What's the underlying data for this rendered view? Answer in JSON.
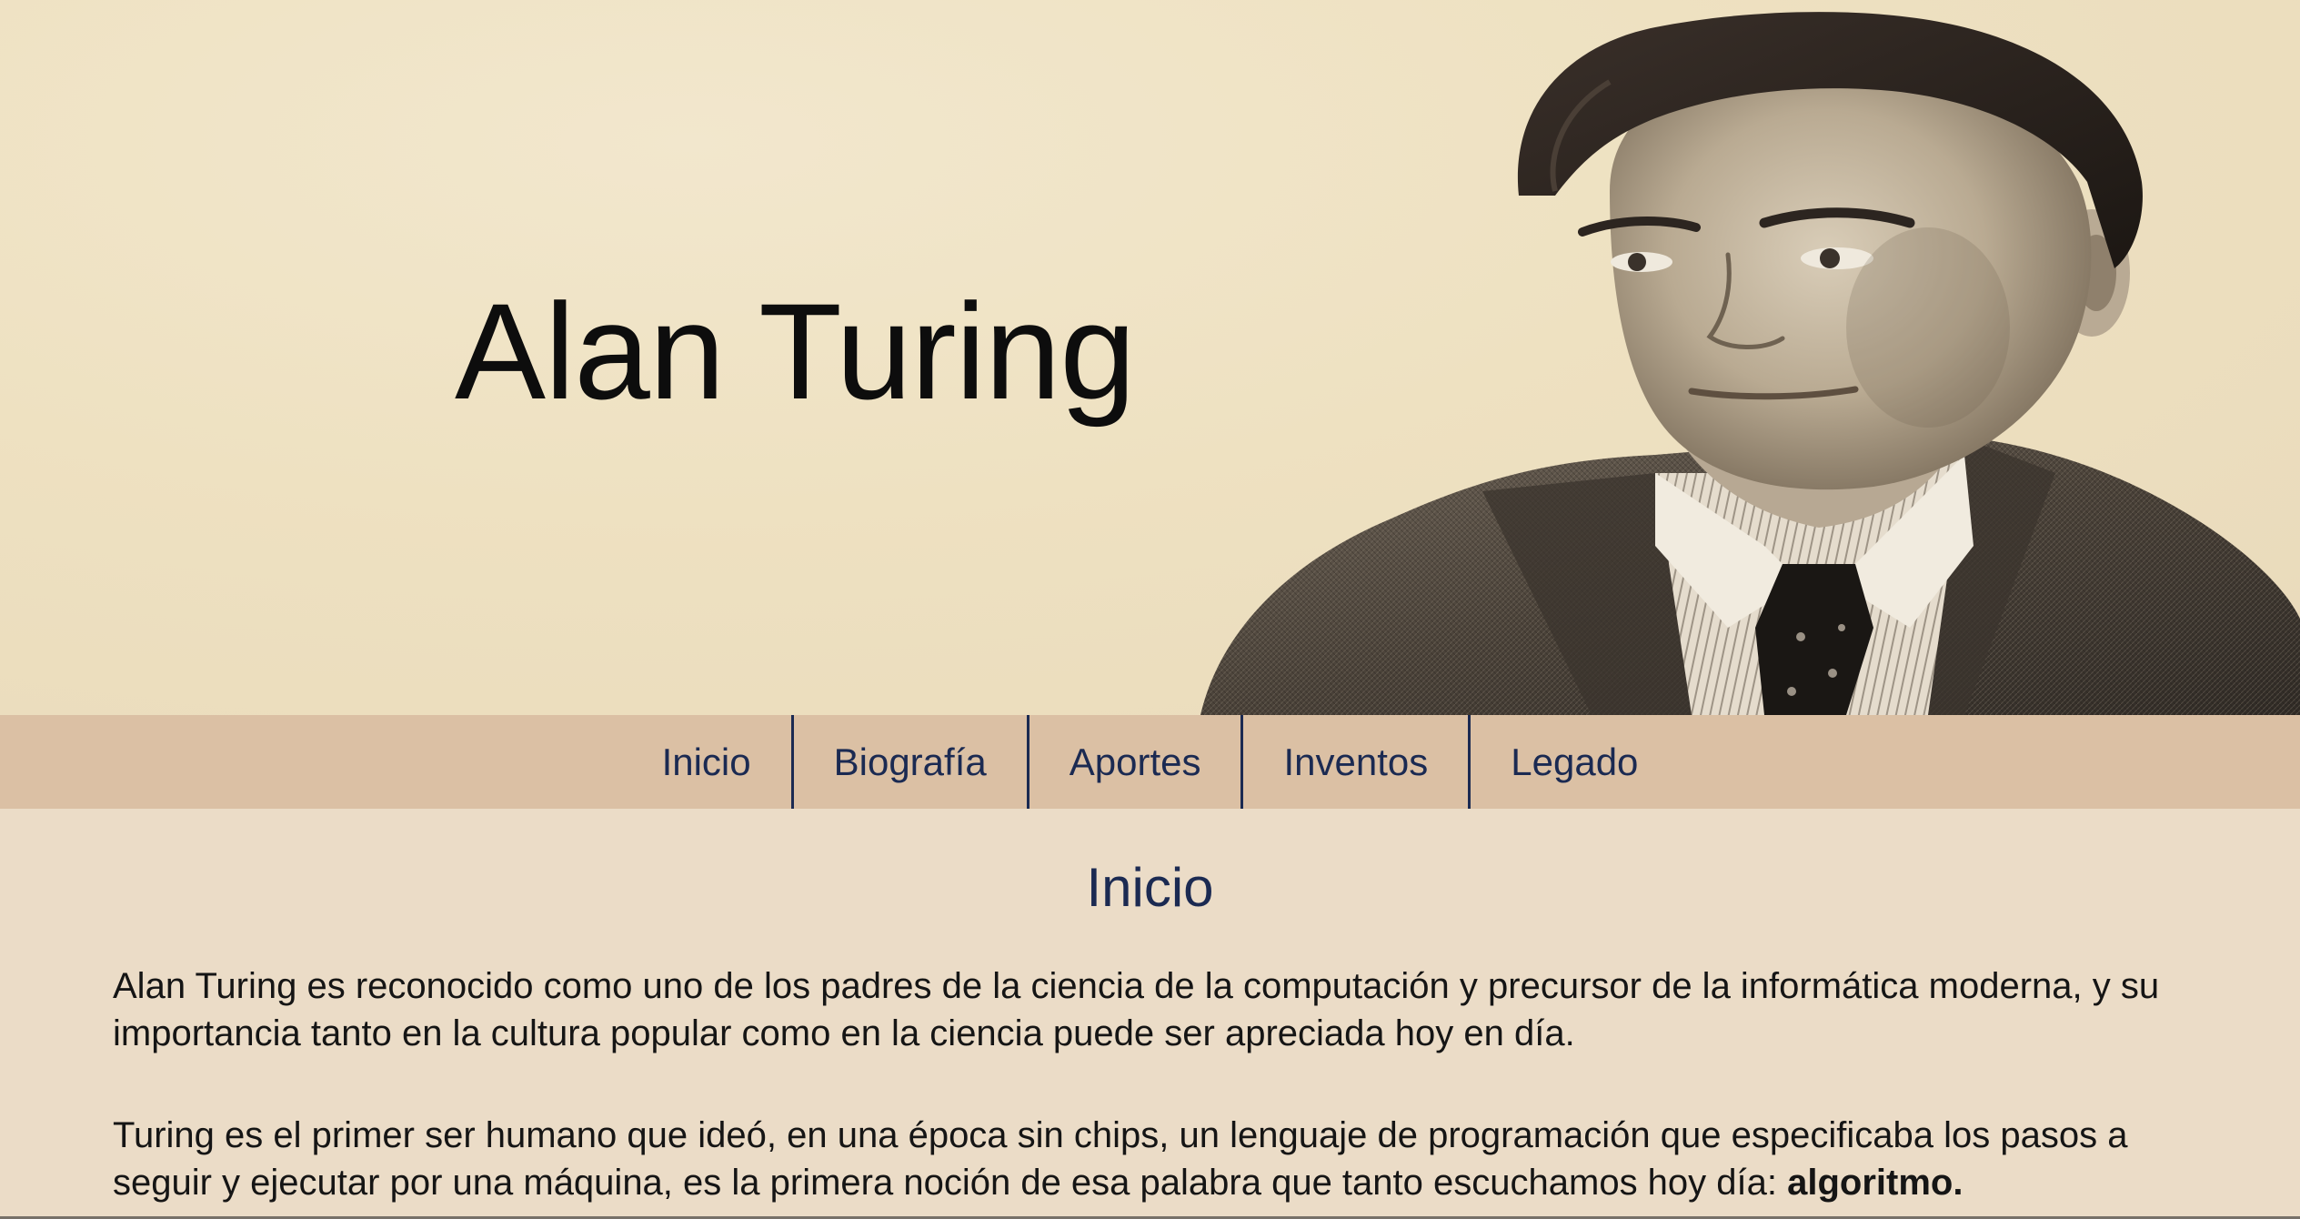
{
  "hero": {
    "title": "Alan Turing",
    "portrait_alt": "Alan Turing portrait"
  },
  "nav": {
    "items": [
      {
        "label": "Inicio"
      },
      {
        "label": "Biografía"
      },
      {
        "label": "Aportes"
      },
      {
        "label": "Inventos"
      },
      {
        "label": "Legado"
      }
    ]
  },
  "main": {
    "section_title": "Inicio",
    "paragraph_1": "Alan Turing es reconocido como uno de los padres de la ciencia de la computación y precursor de la informática moderna, y su importancia tanto en la cultura popular como en la ciencia puede ser apreciada hoy en día.",
    "paragraph_2_prefix": "Turing es el primer ser humano que ideó, en una época sin chips, un lenguaje de programación que especificaba los pasos a seguir y ejecutar por una máquina, es la primera noción de esa palabra que tanto escuchamos hoy día: ",
    "paragraph_2_bold": "algoritmo."
  },
  "colors": {
    "hero_background": "#eee1c1",
    "nav_background": "#dbc0a4",
    "nav_text": "#1b2a52",
    "page_background": "#ebdcc7",
    "body_text": "#151515"
  }
}
